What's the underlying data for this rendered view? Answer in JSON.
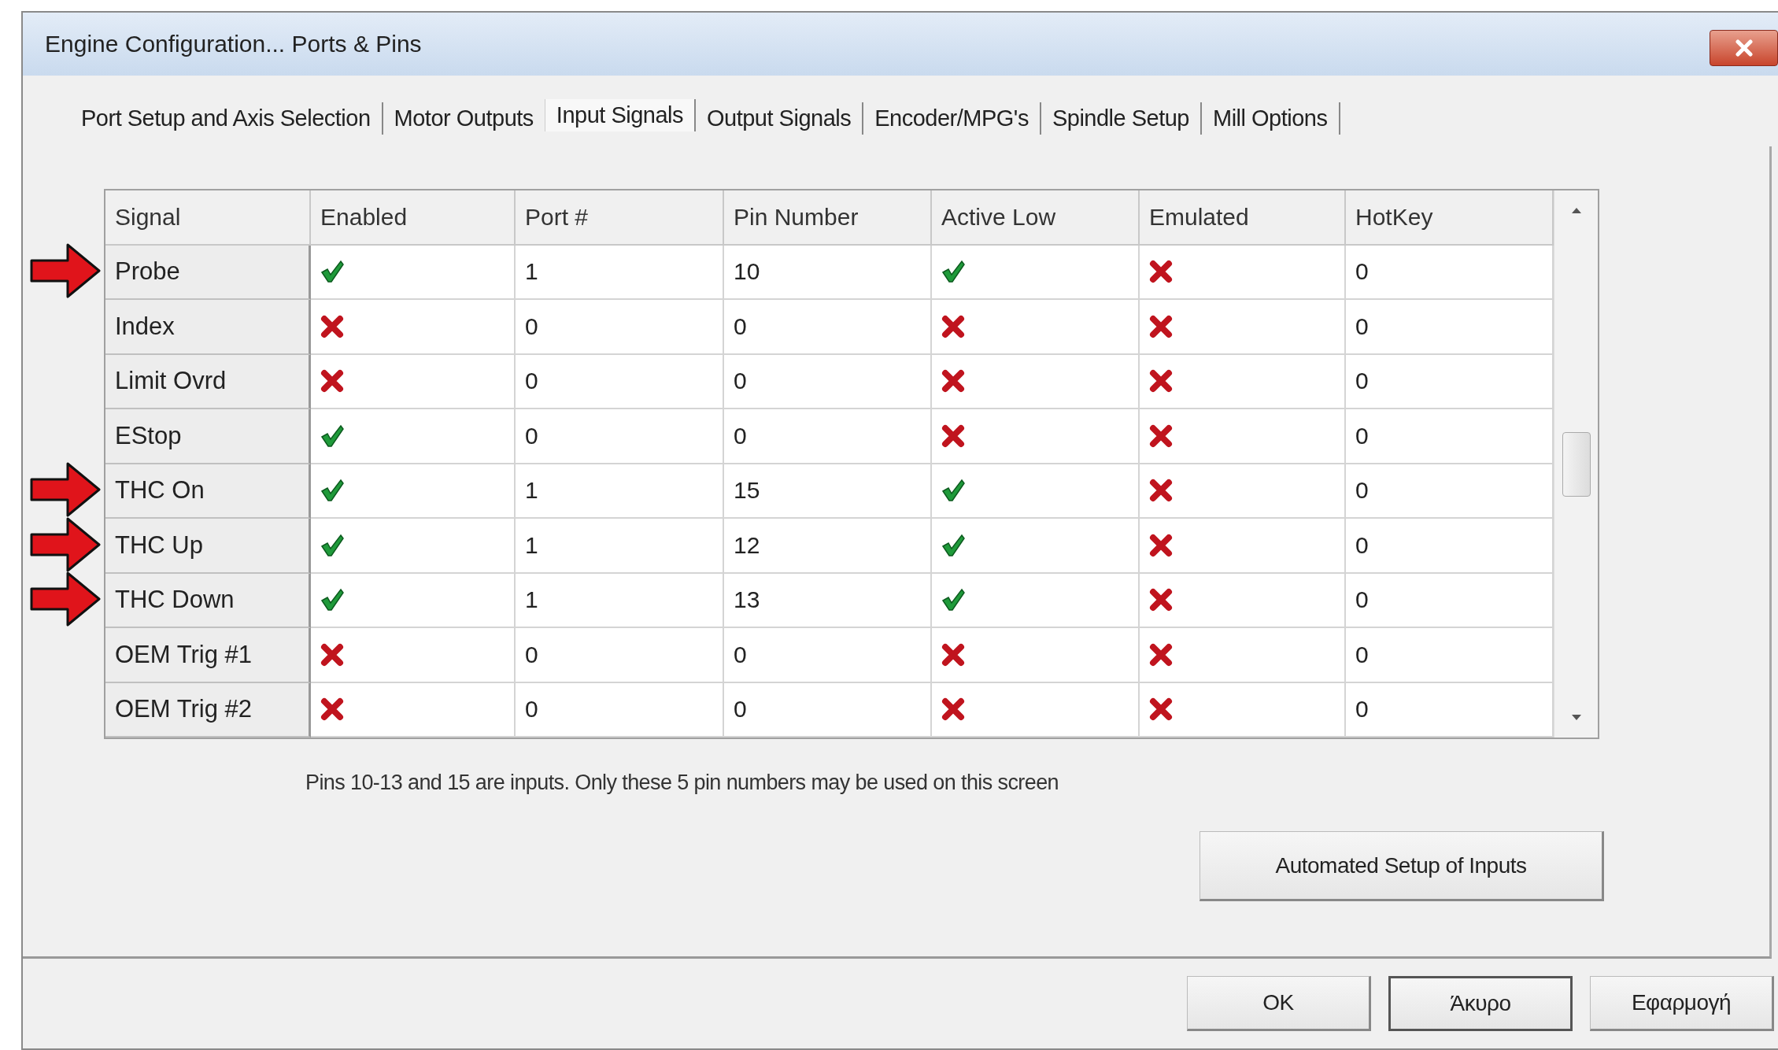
{
  "window": {
    "title": "Engine Configuration... Ports & Pins"
  },
  "tabs": [
    {
      "label": "Port Setup and Axis Selection",
      "selected": false
    },
    {
      "label": "Motor Outputs",
      "selected": false
    },
    {
      "label": "Input Signals",
      "selected": true
    },
    {
      "label": "Output Signals",
      "selected": false
    },
    {
      "label": "Encoder/MPG's",
      "selected": false
    },
    {
      "label": "Spindle Setup",
      "selected": false
    },
    {
      "label": "Mill Options",
      "selected": false
    }
  ],
  "table": {
    "columns": [
      "Signal",
      "Enabled",
      "Port #",
      "Pin Number",
      "Active Low",
      "Emulated",
      "HotKey"
    ],
    "rows": [
      {
        "signal": "Probe",
        "enabled": true,
        "port": "1",
        "pin": "10",
        "active_low": true,
        "emulated": false,
        "hotkey": "0",
        "arrow": true
      },
      {
        "signal": "Index",
        "enabled": false,
        "port": "0",
        "pin": "0",
        "active_low": false,
        "emulated": false,
        "hotkey": "0",
        "arrow": false
      },
      {
        "signal": "Limit Ovrd",
        "enabled": false,
        "port": "0",
        "pin": "0",
        "active_low": false,
        "emulated": false,
        "hotkey": "0",
        "arrow": false
      },
      {
        "signal": "EStop",
        "enabled": true,
        "port": "0",
        "pin": "0",
        "active_low": false,
        "emulated": false,
        "hotkey": "0",
        "arrow": false
      },
      {
        "signal": "THC On",
        "enabled": true,
        "port": "1",
        "pin": "15",
        "active_low": true,
        "emulated": false,
        "hotkey": "0",
        "arrow": true
      },
      {
        "signal": "THC Up",
        "enabled": true,
        "port": "1",
        "pin": "12",
        "active_low": true,
        "emulated": false,
        "hotkey": "0",
        "arrow": true
      },
      {
        "signal": "THC Down",
        "enabled": true,
        "port": "1",
        "pin": "13",
        "active_low": true,
        "emulated": false,
        "hotkey": "0",
        "arrow": true
      },
      {
        "signal": "OEM Trig #1",
        "enabled": false,
        "port": "0",
        "pin": "0",
        "active_low": false,
        "emulated": false,
        "hotkey": "0",
        "arrow": false
      },
      {
        "signal": "OEM Trig #2",
        "enabled": false,
        "port": "0",
        "pin": "0",
        "active_low": false,
        "emulated": false,
        "hotkey": "0",
        "arrow": false
      }
    ]
  },
  "note": "Pins 10-13 and 15 are inputs. Only these 5 pin numbers may be used on this screen",
  "automated_button": "Automated Setup of Inputs",
  "dialog_buttons": [
    {
      "label": "OK",
      "focused": false
    },
    {
      "label": "Άκυρο",
      "focused": true
    },
    {
      "label": "Εφαρμογή",
      "focused": false
    }
  ]
}
